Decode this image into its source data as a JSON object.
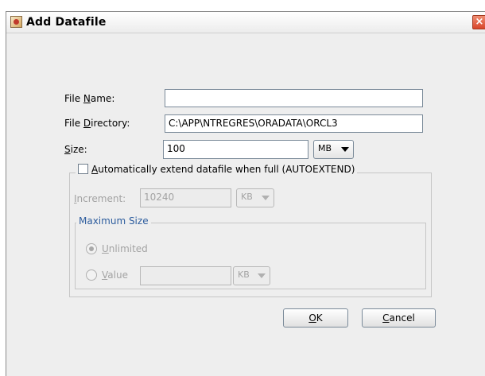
{
  "window": {
    "title": "Add Datafile",
    "close_glyph": "×"
  },
  "form": {
    "file_name_label_pre": "File ",
    "file_name_label_mn": "N",
    "file_name_label_post": "ame:",
    "file_name_value": "",
    "file_directory_label_pre": "File ",
    "file_directory_label_mn": "D",
    "file_directory_label_post": "irectory:",
    "file_directory_value": "C:\\APP\\NTREGRES\\ORADATA\\ORCL3",
    "size_label_mn": "S",
    "size_label_post": "ize:",
    "size_value": "100",
    "size_unit": "MB"
  },
  "autoextend": {
    "checkbox_label_mn": "A",
    "checkbox_label_post": "utomatically extend datafile when full (AUTOEXTEND)",
    "checked": false,
    "increment_label_mn": "I",
    "increment_label_post": "ncrement:",
    "increment_value": "10240",
    "increment_unit": "KB",
    "max_size_legend": "Maximum Size",
    "unlimited_label_mn": "U",
    "unlimited_label_post": "nlimited",
    "value_label_mn": "V",
    "value_label_post": "alue",
    "value_input": "",
    "value_unit": "KB"
  },
  "buttons": {
    "ok_mn": "O",
    "ok_post": "K",
    "cancel_mn": "C",
    "cancel_post": "ancel"
  }
}
